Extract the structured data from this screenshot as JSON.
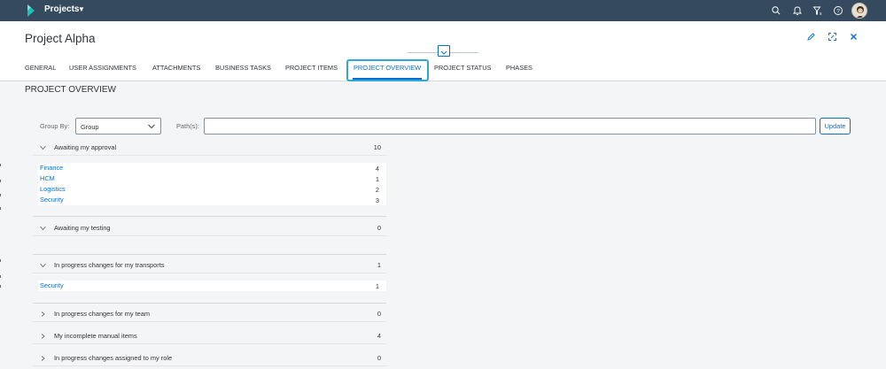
{
  "shell": {
    "app_title": "Projects",
    "brand_color": "#354a5f",
    "logo_color": "#19c2b3",
    "icons": [
      "search-icon",
      "notifications-icon",
      "filter-icon",
      "help-icon",
      "avatar"
    ]
  },
  "header": {
    "title": "Project Alpha",
    "actions": [
      "edit-icon",
      "fullscreen-icon",
      "close-icon"
    ]
  },
  "tabs": [
    {
      "label": "GENERAL"
    },
    {
      "label": "USER ASSIGNMENTS"
    },
    {
      "label": "ATTACHMENTS"
    },
    {
      "label": "BUSINESS TASKS"
    },
    {
      "label": "PROJECT ITEMS"
    },
    {
      "label": "PROJECT OVERVIEW",
      "selected": true
    },
    {
      "label": "PROJECT STATUS"
    },
    {
      "label": "PHASES"
    }
  ],
  "overview": {
    "section_title": "PROJECT OVERVIEW",
    "group_by_label": "Group By:",
    "group_by_value": "Group",
    "paths_label": "Path(s):",
    "paths_value": "",
    "update_label": "Update",
    "groups": [
      {
        "label": "Awaiting my approval",
        "count": "10",
        "expanded": true,
        "rows": [
          {
            "name": "Finance",
            "count": "4"
          },
          {
            "name": "HCM",
            "count": "1"
          },
          {
            "name": "Logistics",
            "count": "2"
          },
          {
            "name": "Security",
            "count": "3"
          }
        ]
      },
      {
        "label": "Awaiting my testing",
        "count": "0",
        "expanded": true,
        "rows": []
      },
      {
        "label": "In progress changes for my transports",
        "count": "1",
        "expanded": true,
        "rows": [
          {
            "name": "Security",
            "count": "1"
          }
        ]
      },
      {
        "label": "In progress changes for my team",
        "count": "0",
        "expanded": false,
        "rows": []
      },
      {
        "label": "My incomplete manual items",
        "count": "4",
        "expanded": false,
        "rows": []
      },
      {
        "label": "In progress changes assigned to my role",
        "count": "0",
        "expanded": false,
        "rows": []
      }
    ]
  }
}
